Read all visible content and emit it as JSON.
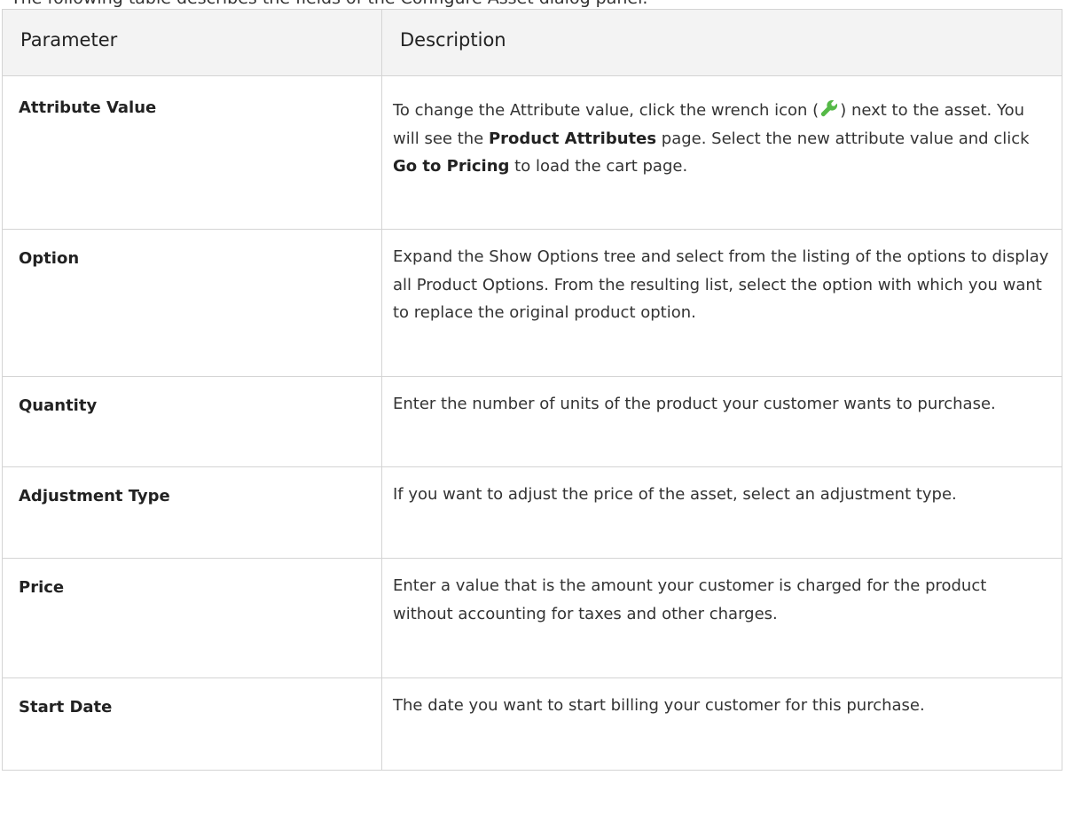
{
  "intro_text": "The following table describes the fields of the Configure Asset dialog panel.",
  "table": {
    "headers": [
      "Parameter",
      "Description"
    ],
    "rows": [
      {
        "parameter": "Attribute Value",
        "desc_parts": [
          "To change the Attribute value, click the wrench icon (",
          ") next to the asset. You will see the ",
          "Product Attributes",
          " page. Select the new attribute value and click ",
          "Go to Pricing",
          " to load the cart page."
        ]
      },
      {
        "parameter": "Option",
        "description": "Expand the Show Options tree and select from the listing of the options to display all Product Options. From the resulting list, select the option with which you want to replace the original product option."
      },
      {
        "parameter": "Quantity",
        "description": "Enter the number of units of the product your customer wants to purchase."
      },
      {
        "parameter": "Adjustment Type",
        "description": "If you want to adjust the price of the asset, select an adjustment type."
      },
      {
        "parameter": "Price",
        "description": "Enter a value that is the amount your customer is charged for the product without accounting for taxes and other charges."
      },
      {
        "parameter": "Start Date",
        "description": "The date you want to start billing your customer for this purchase."
      }
    ]
  },
  "icons": {
    "wrench": "wrench-icon"
  },
  "colors": {
    "wrench": "#55b947",
    "header_bg": "#f3f3f3",
    "border": "#d4d4d4"
  }
}
